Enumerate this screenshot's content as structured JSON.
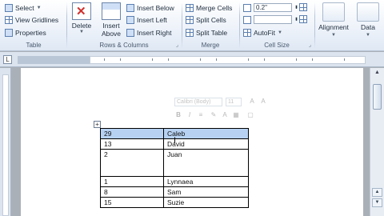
{
  "ribbon": {
    "table_group": {
      "label": "Table",
      "select_label": "Select",
      "gridlines_label": "View Gridlines",
      "properties_label": "Properties"
    },
    "rows_columns_group": {
      "label": "Rows & Columns",
      "delete_label": "Delete",
      "insert_above_line1": "Insert",
      "insert_above_line2": "Above",
      "insert_below_label": "Insert Below",
      "insert_left_label": "Insert Left",
      "insert_right_label": "Insert Right"
    },
    "merge_group": {
      "label": "Merge",
      "merge_cells_label": "Merge Cells",
      "split_cells_label": "Split Cells",
      "split_table_label": "Split Table"
    },
    "cell_size_group": {
      "label": "Cell Size",
      "height_value": "0.2\"",
      "autofit_label": "AutoFit"
    },
    "alignment_label": "Alignment",
    "data_label": "Data"
  },
  "mini_toolbar": {
    "font_value": "Calibri (Body)",
    "size_value": "11"
  },
  "table": {
    "rows": [
      {
        "c1": "29",
        "c2": "Caleb",
        "selected": true
      },
      {
        "c1": "13",
        "c2": "David",
        "selected": false
      },
      {
        "c1": "2",
        "c2": "Juan",
        "selected": false,
        "tall": true
      },
      {
        "c1": "1",
        "c2": "Lynnaea",
        "selected": false
      },
      {
        "c1": "8",
        "c2": "Sam",
        "selected": false
      },
      {
        "c1": "15",
        "c2": "Suzie",
        "selected": false
      }
    ]
  }
}
